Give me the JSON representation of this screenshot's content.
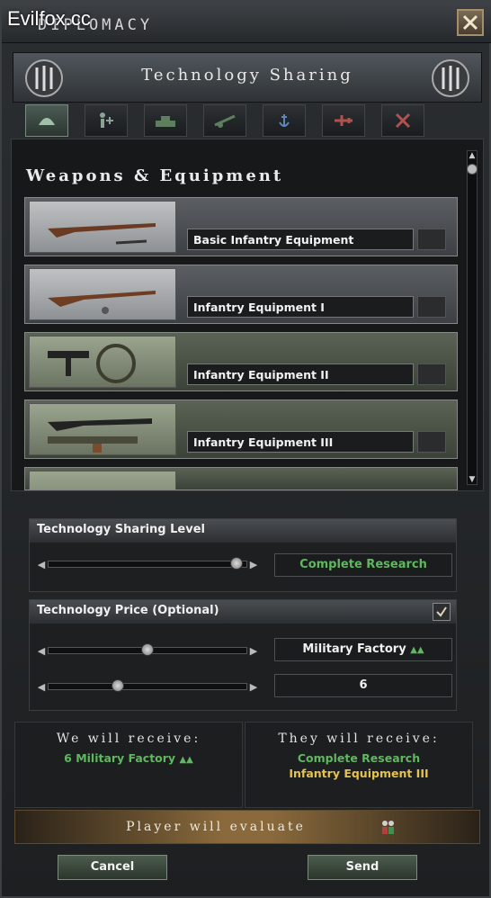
{
  "watermark": "Evilfox.cc",
  "window": {
    "title": "DIPLOMACY",
    "close_icon": "close-x-icon"
  },
  "header": {
    "title": "Technology Sharing"
  },
  "tabs": [
    {
      "name": "infantry-helmet-icon",
      "active": true
    },
    {
      "name": "support-soldiers-icon",
      "active": false
    },
    {
      "name": "tank-icon",
      "active": false
    },
    {
      "name": "artillery-icon",
      "active": false
    },
    {
      "name": "naval-anchor-icon",
      "active": false
    },
    {
      "name": "aircraft-icon",
      "active": false
    },
    {
      "name": "crossed-tools-icon",
      "active": false
    }
  ],
  "list": {
    "heading": "Weapons & Equipment",
    "items": [
      {
        "name": "Basic Infantry Equipment"
      },
      {
        "name": "Infantry Equipment I"
      },
      {
        "name": "Infantry Equipment II"
      },
      {
        "name": "Infantry Equipment III"
      }
    ]
  },
  "sharing_level": {
    "label": "Technology Sharing Level",
    "slider_fraction": 0.98,
    "value": "Complete Research"
  },
  "price": {
    "label": "Technology Price (Optional)",
    "checked": true,
    "type_slider_fraction": 0.5,
    "type_value": "Military Factory",
    "amount_slider_fraction": 0.35,
    "amount_value": "6"
  },
  "we_receive": {
    "title": "We will receive:",
    "line": "6 Military Factory"
  },
  "they_receive": {
    "title": "They will receive:",
    "line1": "Complete Research",
    "line2": "Infantry Equipment III"
  },
  "evaluate": {
    "text": "Player will evaluate"
  },
  "buttons": {
    "cancel": "Cancel",
    "send": "Send"
  },
  "colors": {
    "green_text": "#5fb85f",
    "yellow_text": "#e7c34a"
  }
}
